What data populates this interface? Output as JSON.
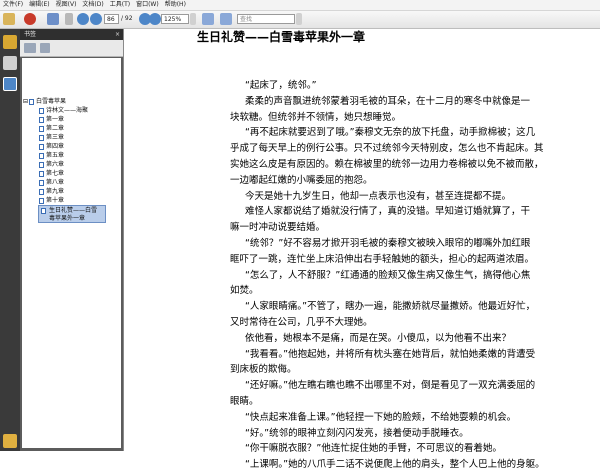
{
  "menu": [
    "文件(F)",
    "编辑(E)",
    "视图(V)",
    "文档(D)",
    "工具(T)",
    "窗口(W)",
    "帮助(H)"
  ],
  "toolbar": {
    "page_current": "86",
    "page_total": "/ 92",
    "zoom": "125%",
    "search_placeholder": "查找"
  },
  "bookmarks": {
    "header": "书签",
    "root": "白雪毒苹果",
    "items": [
      "诗林文——海聚",
      "第一章",
      "第二章",
      "第三章",
      "第四章",
      "第五章",
      "第六章",
      "第七章",
      "第八章",
      "第九章",
      "第十章"
    ],
    "selected": [
      "生日礼赞——白雪",
      "毒苹果外一章"
    ]
  },
  "document": {
    "title": "生日礼赞——白雪毒苹果外一章",
    "lines": [
      {
        "t": "“起床了，统邻。”",
        "c": false
      },
      {
        "t": "柔柔的声音飘进统邻蒙着羽毛被的耳朵，在十二月的寒冬中就像是一",
        "c": false
      },
      {
        "t": "块软糖。但统邻并不领情，她只想睡觉。",
        "c": true
      },
      {
        "t": "“再不起床就要迟到了哦。”秦穆文无奈的放下托盘，动手掀棉被；这几",
        "c": false
      },
      {
        "t": "乎成了每天早上的例行公事。只不过统邻今天特别皮，怎么也不肯起床。其",
        "c": true
      },
      {
        "t": "实她这么皮是有原因的。赖在棉被里的统邻一边用力卷棉被以免不被而散，",
        "c": true
      },
      {
        "t": "一边嘟起红嫩的小嘴委屈的抱怨。",
        "c": true
      },
      {
        "t": "今天是她十九岁生日，他却一点表示也没有，甚至连提都不提。",
        "c": false
      },
      {
        "t": "难怪人家都说结了婚就没行情了，真的没错。早知道订婚就算了，干",
        "c": false
      },
      {
        "t": "嘛一时冲动说要结婚。",
        "c": true
      },
      {
        "t": "“统邻？”好不容易才掀开羽毛被的秦穆文被映入眼帘的嘟嘴外加红眼",
        "c": false
      },
      {
        "t": "眶吓了一跳，连忙坐上床沿伸出右手轻触她的额头，担心的起两道浓眉。",
        "c": true
      },
      {
        "t": "“怎么了，人不舒服？”红通通的脸颊又像生病又像生气，搞得他心焦",
        "c": false
      },
      {
        "t": "如焚。",
        "c": true
      },
      {
        "t": "“人家眼睛痛。”不管了，瞎办一遍，能撒娇就尽量撒娇。他最近好忙，",
        "c": false
      },
      {
        "t": "又时常待在公司，几乎不大理她。",
        "c": true
      },
      {
        "t": "依他看，她根本不是痛，而是在哭。小傻瓜，以为他看不出来？",
        "c": false
      },
      {
        "t": "“我看看。”他抱起她，并将所有枕头塞在她背后，就怕她柔嫩的背遭受",
        "c": false
      },
      {
        "t": "到床板的欺侮。",
        "c": true
      },
      {
        "t": "“还好嘛。”他左瞧右瞧也瞧不出哪里不对，倒是看见了一双充满委屈的",
        "c": false
      },
      {
        "t": "眼睛。",
        "c": true
      },
      {
        "t": "“快点起来准备上课。”他轻捏一下她的脸颊，不给她耍赖的机会。",
        "c": false
      },
      {
        "t": "“好。”统邻的眼神立刻闪闪发亮，接着便动手脱睡衣。",
        "c": false
      },
      {
        "t": "“你干嘛脱衣服？”他连忙捉住她的手臂，不可思议的看着她。",
        "c": false
      },
      {
        "t": "“上课啊。”她的八爪手二话不说便爬上他的肩头，整个人巴上他的身躯。",
        "c": false
      }
    ]
  }
}
